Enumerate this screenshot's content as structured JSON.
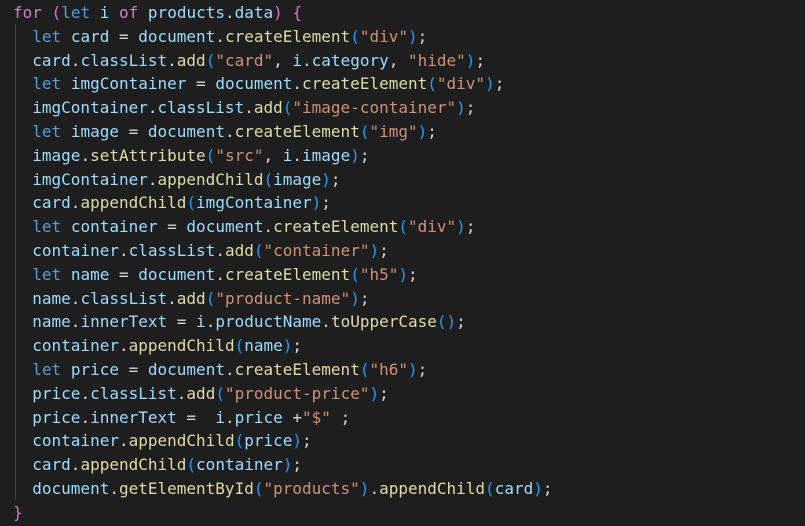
{
  "editor": {
    "colors": {
      "background": "#1e1e1e",
      "keyword": "#569cd6",
      "control": "#c586c0",
      "variable": "#9cdcfe",
      "function": "#dcdcaa",
      "string": "#ce9178",
      "default": "#d4d4d4",
      "brace": "#ffd700",
      "paren_level_2": "#da70d6",
      "paren_level_3": "#179fff"
    },
    "lines": [
      [
        [
          "control",
          "for"
        ],
        [
          "default",
          " "
        ],
        [
          "paren-2",
          "("
        ],
        [
          "keyword",
          "let"
        ],
        [
          "default",
          " "
        ],
        [
          "variable",
          "i"
        ],
        [
          "default",
          " "
        ],
        [
          "control",
          "of"
        ],
        [
          "default",
          " "
        ],
        [
          "variable",
          "products"
        ],
        [
          "default",
          "."
        ],
        [
          "variable",
          "data"
        ],
        [
          "paren-2",
          ")"
        ],
        [
          "default",
          " "
        ],
        [
          "paren-2",
          "{"
        ]
      ],
      [
        [
          "default",
          "  "
        ],
        [
          "keyword",
          "let"
        ],
        [
          "default",
          " "
        ],
        [
          "variable",
          "card"
        ],
        [
          "default",
          " = "
        ],
        [
          "variable",
          "document"
        ],
        [
          "default",
          "."
        ],
        [
          "function",
          "createElement"
        ],
        [
          "paren-3",
          "("
        ],
        [
          "string",
          "\"div\""
        ],
        [
          "paren-3",
          ")"
        ],
        [
          "default",
          ";"
        ]
      ],
      [
        [
          "default",
          "  "
        ],
        [
          "variable",
          "card"
        ],
        [
          "default",
          "."
        ],
        [
          "variable",
          "classList"
        ],
        [
          "default",
          "."
        ],
        [
          "function",
          "add"
        ],
        [
          "paren-3",
          "("
        ],
        [
          "string",
          "\"card\""
        ],
        [
          "default",
          ", "
        ],
        [
          "variable",
          "i"
        ],
        [
          "default",
          "."
        ],
        [
          "variable",
          "category"
        ],
        [
          "default",
          ", "
        ],
        [
          "string",
          "\"hide\""
        ],
        [
          "paren-3",
          ")"
        ],
        [
          "default",
          ";"
        ]
      ],
      [
        [
          "default",
          "  "
        ],
        [
          "keyword",
          "let"
        ],
        [
          "default",
          " "
        ],
        [
          "variable",
          "imgContainer"
        ],
        [
          "default",
          " = "
        ],
        [
          "variable",
          "document"
        ],
        [
          "default",
          "."
        ],
        [
          "function",
          "createElement"
        ],
        [
          "paren-3",
          "("
        ],
        [
          "string",
          "\"div\""
        ],
        [
          "paren-3",
          ")"
        ],
        [
          "default",
          ";"
        ]
      ],
      [
        [
          "default",
          "  "
        ],
        [
          "variable",
          "imgContainer"
        ],
        [
          "default",
          "."
        ],
        [
          "variable",
          "classList"
        ],
        [
          "default",
          "."
        ],
        [
          "function",
          "add"
        ],
        [
          "paren-3",
          "("
        ],
        [
          "string",
          "\"image-container\""
        ],
        [
          "paren-3",
          ")"
        ],
        [
          "default",
          ";"
        ]
      ],
      [
        [
          "default",
          "  "
        ],
        [
          "keyword",
          "let"
        ],
        [
          "default",
          " "
        ],
        [
          "variable",
          "image"
        ],
        [
          "default",
          " = "
        ],
        [
          "variable",
          "document"
        ],
        [
          "default",
          "."
        ],
        [
          "function",
          "createElement"
        ],
        [
          "paren-3",
          "("
        ],
        [
          "string",
          "\"img\""
        ],
        [
          "paren-3",
          ")"
        ],
        [
          "default",
          ";"
        ]
      ],
      [
        [
          "default",
          "  "
        ],
        [
          "variable",
          "image"
        ],
        [
          "default",
          "."
        ],
        [
          "function",
          "setAttribute"
        ],
        [
          "paren-3",
          "("
        ],
        [
          "string",
          "\"src\""
        ],
        [
          "default",
          ", "
        ],
        [
          "variable",
          "i"
        ],
        [
          "default",
          "."
        ],
        [
          "variable",
          "image"
        ],
        [
          "paren-3",
          ")"
        ],
        [
          "default",
          ";"
        ]
      ],
      [
        [
          "default",
          "  "
        ],
        [
          "variable",
          "imgContainer"
        ],
        [
          "default",
          "."
        ],
        [
          "function",
          "appendChild"
        ],
        [
          "paren-3",
          "("
        ],
        [
          "variable",
          "image"
        ],
        [
          "paren-3",
          ")"
        ],
        [
          "default",
          ";"
        ]
      ],
      [
        [
          "default",
          "  "
        ],
        [
          "variable",
          "card"
        ],
        [
          "default",
          "."
        ],
        [
          "function",
          "appendChild"
        ],
        [
          "paren-3",
          "("
        ],
        [
          "variable",
          "imgContainer"
        ],
        [
          "paren-3",
          ")"
        ],
        [
          "default",
          ";"
        ]
      ],
      [
        [
          "default",
          "  "
        ],
        [
          "keyword",
          "let"
        ],
        [
          "default",
          " "
        ],
        [
          "variable",
          "container"
        ],
        [
          "default",
          " = "
        ],
        [
          "variable",
          "document"
        ],
        [
          "default",
          "."
        ],
        [
          "function",
          "createElement"
        ],
        [
          "paren-3",
          "("
        ],
        [
          "string",
          "\"div\""
        ],
        [
          "paren-3",
          ")"
        ],
        [
          "default",
          ";"
        ]
      ],
      [
        [
          "default",
          "  "
        ],
        [
          "variable",
          "container"
        ],
        [
          "default",
          "."
        ],
        [
          "variable",
          "classList"
        ],
        [
          "default",
          "."
        ],
        [
          "function",
          "add"
        ],
        [
          "paren-3",
          "("
        ],
        [
          "string",
          "\"container\""
        ],
        [
          "paren-3",
          ")"
        ],
        [
          "default",
          ";"
        ]
      ],
      [
        [
          "default",
          "  "
        ],
        [
          "keyword",
          "let"
        ],
        [
          "default",
          " "
        ],
        [
          "variable",
          "name"
        ],
        [
          "default",
          " = "
        ],
        [
          "variable",
          "document"
        ],
        [
          "default",
          "."
        ],
        [
          "function",
          "createElement"
        ],
        [
          "paren-3",
          "("
        ],
        [
          "string",
          "\"h5\""
        ],
        [
          "paren-3",
          ")"
        ],
        [
          "default",
          ";"
        ]
      ],
      [
        [
          "default",
          "  "
        ],
        [
          "variable",
          "name"
        ],
        [
          "default",
          "."
        ],
        [
          "variable",
          "classList"
        ],
        [
          "default",
          "."
        ],
        [
          "function",
          "add"
        ],
        [
          "paren-3",
          "("
        ],
        [
          "string",
          "\"product-name\""
        ],
        [
          "paren-3",
          ")"
        ],
        [
          "default",
          ";"
        ]
      ],
      [
        [
          "default",
          "  "
        ],
        [
          "variable",
          "name"
        ],
        [
          "default",
          "."
        ],
        [
          "variable",
          "innerText"
        ],
        [
          "default",
          " = "
        ],
        [
          "variable",
          "i"
        ],
        [
          "default",
          "."
        ],
        [
          "variable",
          "productName"
        ],
        [
          "default",
          "."
        ],
        [
          "function",
          "toUpperCase"
        ],
        [
          "paren-3",
          "()"
        ],
        [
          "default",
          ";"
        ]
      ],
      [
        [
          "default",
          "  "
        ],
        [
          "variable",
          "container"
        ],
        [
          "default",
          "."
        ],
        [
          "function",
          "appendChild"
        ],
        [
          "paren-3",
          "("
        ],
        [
          "variable",
          "name"
        ],
        [
          "paren-3",
          ")"
        ],
        [
          "default",
          ";"
        ]
      ],
      [
        [
          "default",
          "  "
        ],
        [
          "keyword",
          "let"
        ],
        [
          "default",
          " "
        ],
        [
          "variable",
          "price"
        ],
        [
          "default",
          " = "
        ],
        [
          "variable",
          "document"
        ],
        [
          "default",
          "."
        ],
        [
          "function",
          "createElement"
        ],
        [
          "paren-3",
          "("
        ],
        [
          "string",
          "\"h6\""
        ],
        [
          "paren-3",
          ")"
        ],
        [
          "default",
          ";"
        ]
      ],
      [
        [
          "default",
          "  "
        ],
        [
          "variable",
          "price"
        ],
        [
          "default",
          "."
        ],
        [
          "variable",
          "classList"
        ],
        [
          "default",
          "."
        ],
        [
          "function",
          "add"
        ],
        [
          "paren-3",
          "("
        ],
        [
          "string",
          "\"product-price\""
        ],
        [
          "paren-3",
          ")"
        ],
        [
          "default",
          ";"
        ]
      ],
      [
        [
          "default",
          "  "
        ],
        [
          "variable",
          "price"
        ],
        [
          "default",
          "."
        ],
        [
          "variable",
          "innerText"
        ],
        [
          "default",
          " =  "
        ],
        [
          "variable",
          "i"
        ],
        [
          "default",
          "."
        ],
        [
          "variable",
          "price"
        ],
        [
          "default",
          " +"
        ],
        [
          "string",
          "\"$\""
        ],
        [
          "default",
          " ;"
        ]
      ],
      [
        [
          "default",
          "  "
        ],
        [
          "variable",
          "container"
        ],
        [
          "default",
          "."
        ],
        [
          "function",
          "appendChild"
        ],
        [
          "paren-3",
          "("
        ],
        [
          "variable",
          "price"
        ],
        [
          "paren-3",
          ")"
        ],
        [
          "default",
          ";"
        ]
      ],
      [
        [
          "default",
          "  "
        ],
        [
          "variable",
          "card"
        ],
        [
          "default",
          "."
        ],
        [
          "function",
          "appendChild"
        ],
        [
          "paren-3",
          "("
        ],
        [
          "variable",
          "container"
        ],
        [
          "paren-3",
          ")"
        ],
        [
          "default",
          ";"
        ]
      ],
      [
        [
          "default",
          "  "
        ],
        [
          "variable",
          "document"
        ],
        [
          "default",
          "."
        ],
        [
          "function",
          "getElementById"
        ],
        [
          "paren-3",
          "("
        ],
        [
          "string",
          "\"products\""
        ],
        [
          "paren-3",
          ")"
        ],
        [
          "default",
          "."
        ],
        [
          "function",
          "appendChild"
        ],
        [
          "paren-3",
          "("
        ],
        [
          "variable",
          "card"
        ],
        [
          "paren-3",
          ")"
        ],
        [
          "default",
          ";"
        ]
      ],
      [
        [
          "paren-2",
          "}"
        ]
      ]
    ]
  }
}
